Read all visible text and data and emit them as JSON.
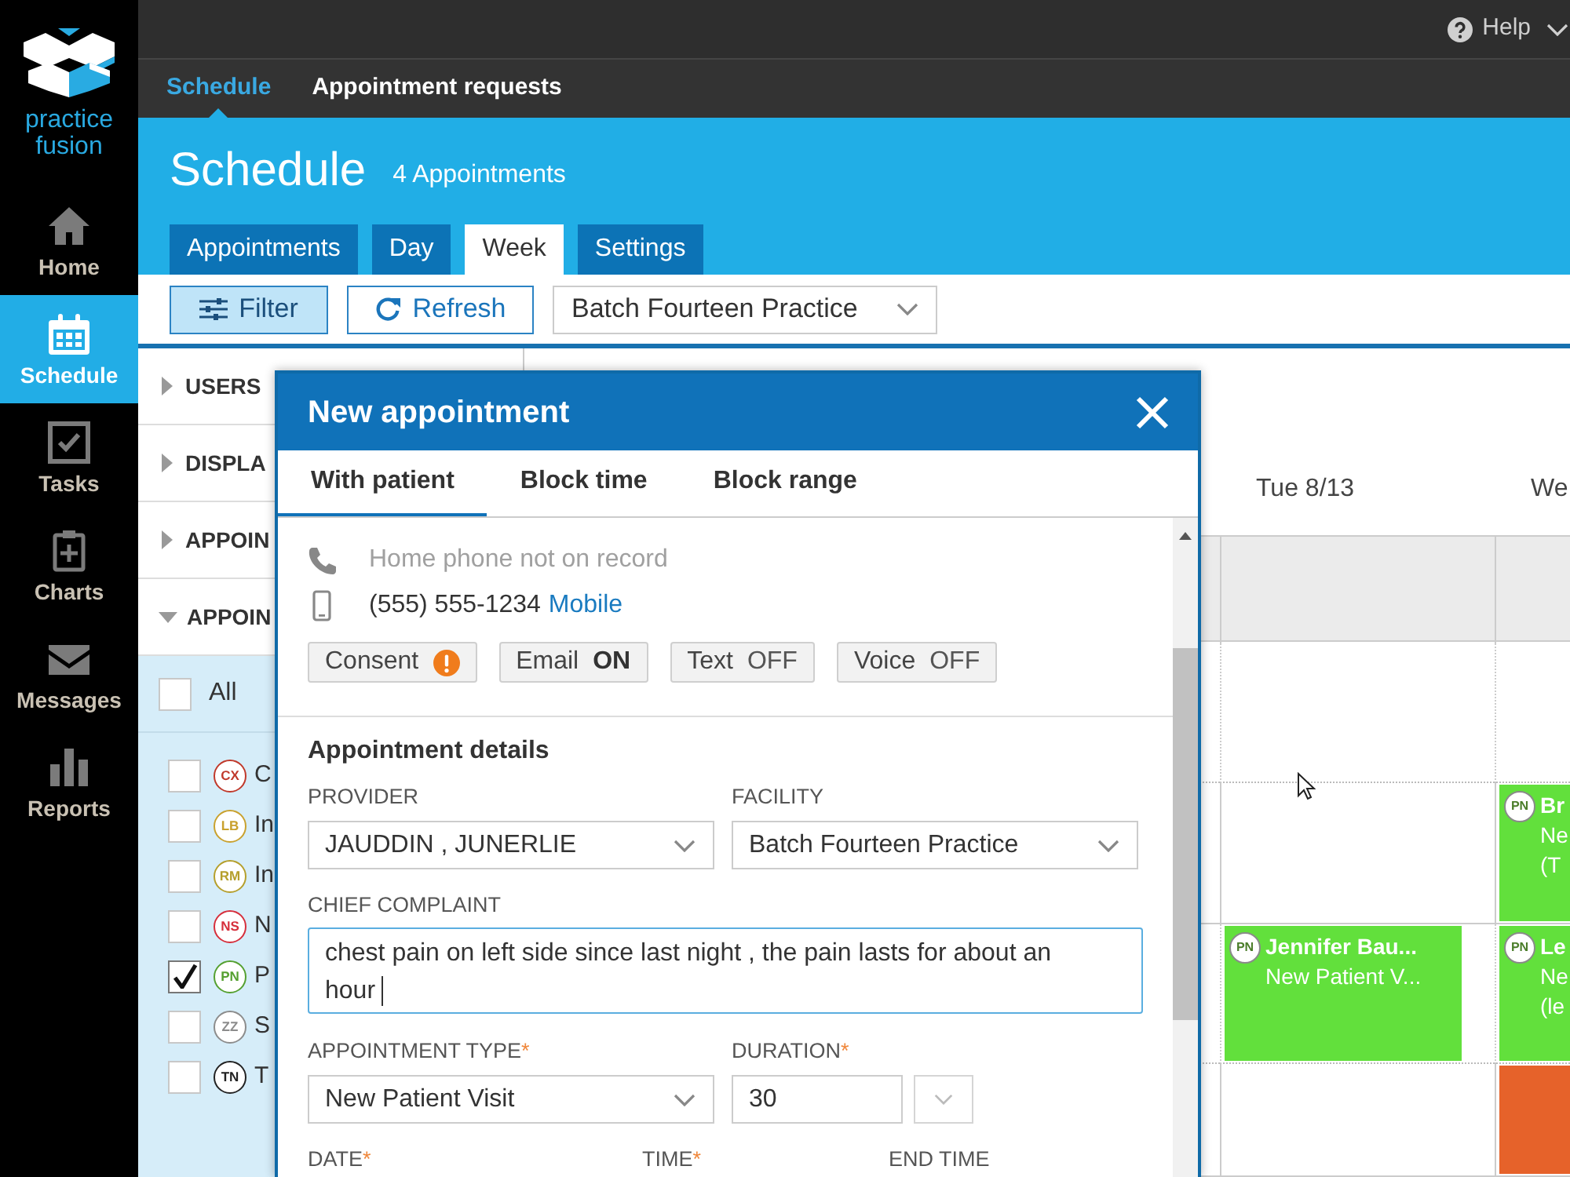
{
  "nav": {
    "brand": "practice fusion",
    "items": [
      {
        "label": "Home",
        "selected": false
      },
      {
        "label": "Schedule",
        "selected": true
      },
      {
        "label": "Tasks",
        "selected": false
      },
      {
        "label": "Charts",
        "selected": false
      },
      {
        "label": "Messages",
        "selected": false
      },
      {
        "label": "Reports",
        "selected": false
      }
    ]
  },
  "top_bar": {
    "help": "Help"
  },
  "subnav": [
    {
      "label": "Schedule",
      "selected": true
    },
    {
      "label": "Appointment requests",
      "selected": false
    }
  ],
  "header": {
    "title": "Schedule",
    "count": "4 Appointments"
  },
  "tabs": [
    {
      "label": "Appointments",
      "selected": false
    },
    {
      "label": "Day",
      "selected": false
    },
    {
      "label": "Week",
      "selected": true
    },
    {
      "label": "Settings",
      "selected": false
    }
  ],
  "toolbar": {
    "filter": {
      "label": "Filter",
      "active": true
    },
    "refresh": "Refresh",
    "facility": "Batch Fourteen Practice"
  },
  "filter_panel": {
    "sections": [
      {
        "label": "USERS",
        "expanded": false
      },
      {
        "label": "DISPLA",
        "expanded": false
      },
      {
        "label": "APPOIN",
        "expanded": false
      },
      {
        "label": "APPOIN",
        "expanded": true
      }
    ],
    "all": {
      "label": "All",
      "checked": false
    },
    "types": [
      {
        "code": "CX",
        "label": "C",
        "color": "#c0392b",
        "checked": false
      },
      {
        "code": "LB",
        "label": "In",
        "color": "#c9a12e",
        "checked": false
      },
      {
        "code": "RM",
        "label": "In",
        "color": "#b59f2c",
        "checked": false
      },
      {
        "code": "NS",
        "label": "N",
        "color": "#d62f3c",
        "checked": false
      },
      {
        "code": "PN",
        "label": "P",
        "color": "#55a030",
        "checked": true
      },
      {
        "code": "ZZ",
        "label": "S",
        "color": "#8c8c8c",
        "checked": false
      },
      {
        "code": "TN",
        "label": "T",
        "color": "#222222",
        "checked": false
      }
    ]
  },
  "calendar": {
    "days": [
      {
        "label": "Tue 8/13",
        "slots": [
          {
            "kind": "empty"
          },
          {
            "kind": "empty"
          },
          {
            "kind": "event",
            "color": "#62e03c",
            "badge": "PN",
            "title": "Jennifer Bau...",
            "lines": [
              "New Patient V..."
            ]
          },
          {
            "kind": "empty"
          }
        ]
      },
      {
        "label": "We",
        "slots": [
          {
            "kind": "empty"
          },
          {
            "kind": "event",
            "color": "#62e03c",
            "badge": "PN",
            "title": "Br",
            "lines": [
              "Ne",
              "(T"
            ]
          },
          {
            "kind": "event",
            "color": "#62e03c",
            "badge": "PN",
            "title": "Le",
            "lines": [
              "Ne",
              "(le"
            ]
          },
          {
            "kind": "event",
            "color": "#e6622a"
          }
        ]
      }
    ]
  },
  "modal": {
    "title": "New appointment",
    "tabs": [
      {
        "label": "With patient",
        "selected": true
      },
      {
        "label": "Block time",
        "selected": false
      },
      {
        "label": "Block range",
        "selected": false
      }
    ],
    "contact": [
      {
        "kind": "phone",
        "text": "Home phone not on record",
        "on_record": false
      },
      {
        "kind": "mobile",
        "text": "(555) 555-1234",
        "type": "Mobile",
        "on_record": true
      }
    ],
    "consents": [
      {
        "kind": "alert",
        "label": "Consent"
      },
      {
        "kind": "toggle",
        "label": "Email",
        "value": "ON",
        "on": true
      },
      {
        "kind": "toggle",
        "label": "Text",
        "value": "OFF",
        "on": false
      },
      {
        "kind": "toggle",
        "label": "Voice",
        "value": "OFF",
        "on": false
      }
    ],
    "section_title": "Appointment details",
    "provider": {
      "label": "PROVIDER",
      "value": "JAUDDIN , JUNERLIE"
    },
    "facility": {
      "label": "FACILITY",
      "value": "Batch Fourteen Practice"
    },
    "chief_complaint": {
      "label": "CHIEF COMPLAINT",
      "value": "chest pain on left side since last night , the pain lasts for about an hour"
    },
    "appointment_type": {
      "label": "APPOINTMENT TYPE",
      "required_mark": "*",
      "value": "New Patient Visit"
    },
    "duration": {
      "label": "DURATION",
      "required_mark": "*",
      "value": "30"
    },
    "schedule_fields": [
      {
        "label": "DATE",
        "required_mark": "*"
      },
      {
        "label": "TIME",
        "required_mark": "*"
      },
      {
        "label": "END TIME"
      }
    ]
  }
}
